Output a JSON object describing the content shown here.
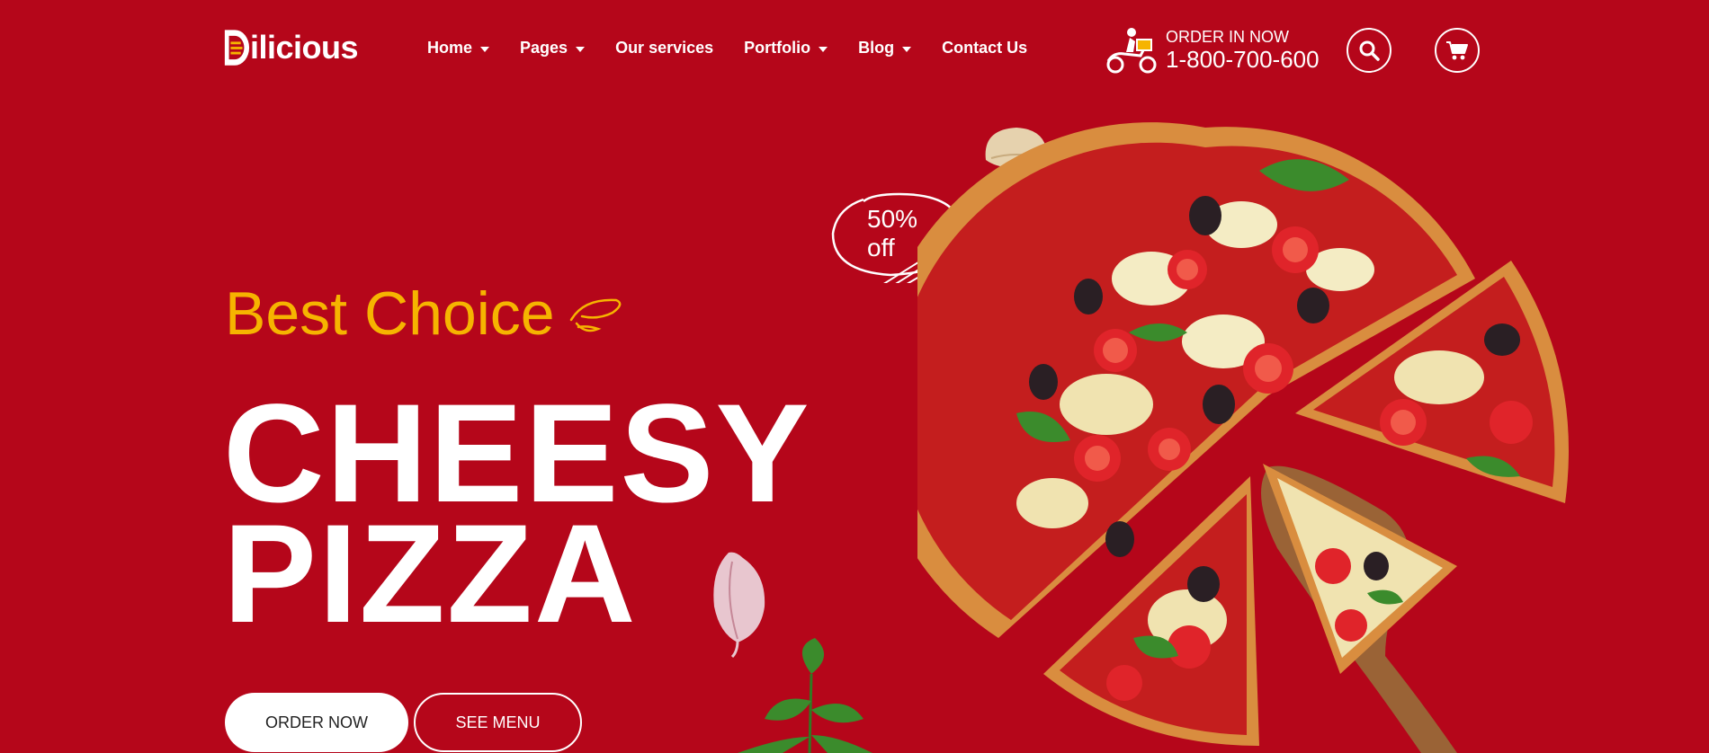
{
  "header": {
    "logo_text": "ilicious",
    "nav": [
      {
        "label": "Home",
        "dropdown": true
      },
      {
        "label": "Pages",
        "dropdown": true
      },
      {
        "label": "Our services",
        "dropdown": false
      },
      {
        "label": "Portfolio",
        "dropdown": true
      },
      {
        "label": "Blog",
        "dropdown": true
      },
      {
        "label": "Contact Us",
        "dropdown": false
      }
    ],
    "order_label": "ORDER IN NOW",
    "order_phone": "1-800-700-600",
    "icons": {
      "search": "search-icon",
      "cart": "cart-icon",
      "delivery": "delivery-scooter-icon"
    }
  },
  "hero": {
    "tagline": "Best Choice",
    "headline_line1": "CHEESY",
    "headline_line2": "PIZZA",
    "order_button": "ORDER NOW",
    "menu_button": "SEE MENU",
    "badge_percent": "50%",
    "badge_off": "off"
  },
  "colors": {
    "background": "#b5061a",
    "accent": "#f6b400",
    "text": "#ffffff"
  }
}
